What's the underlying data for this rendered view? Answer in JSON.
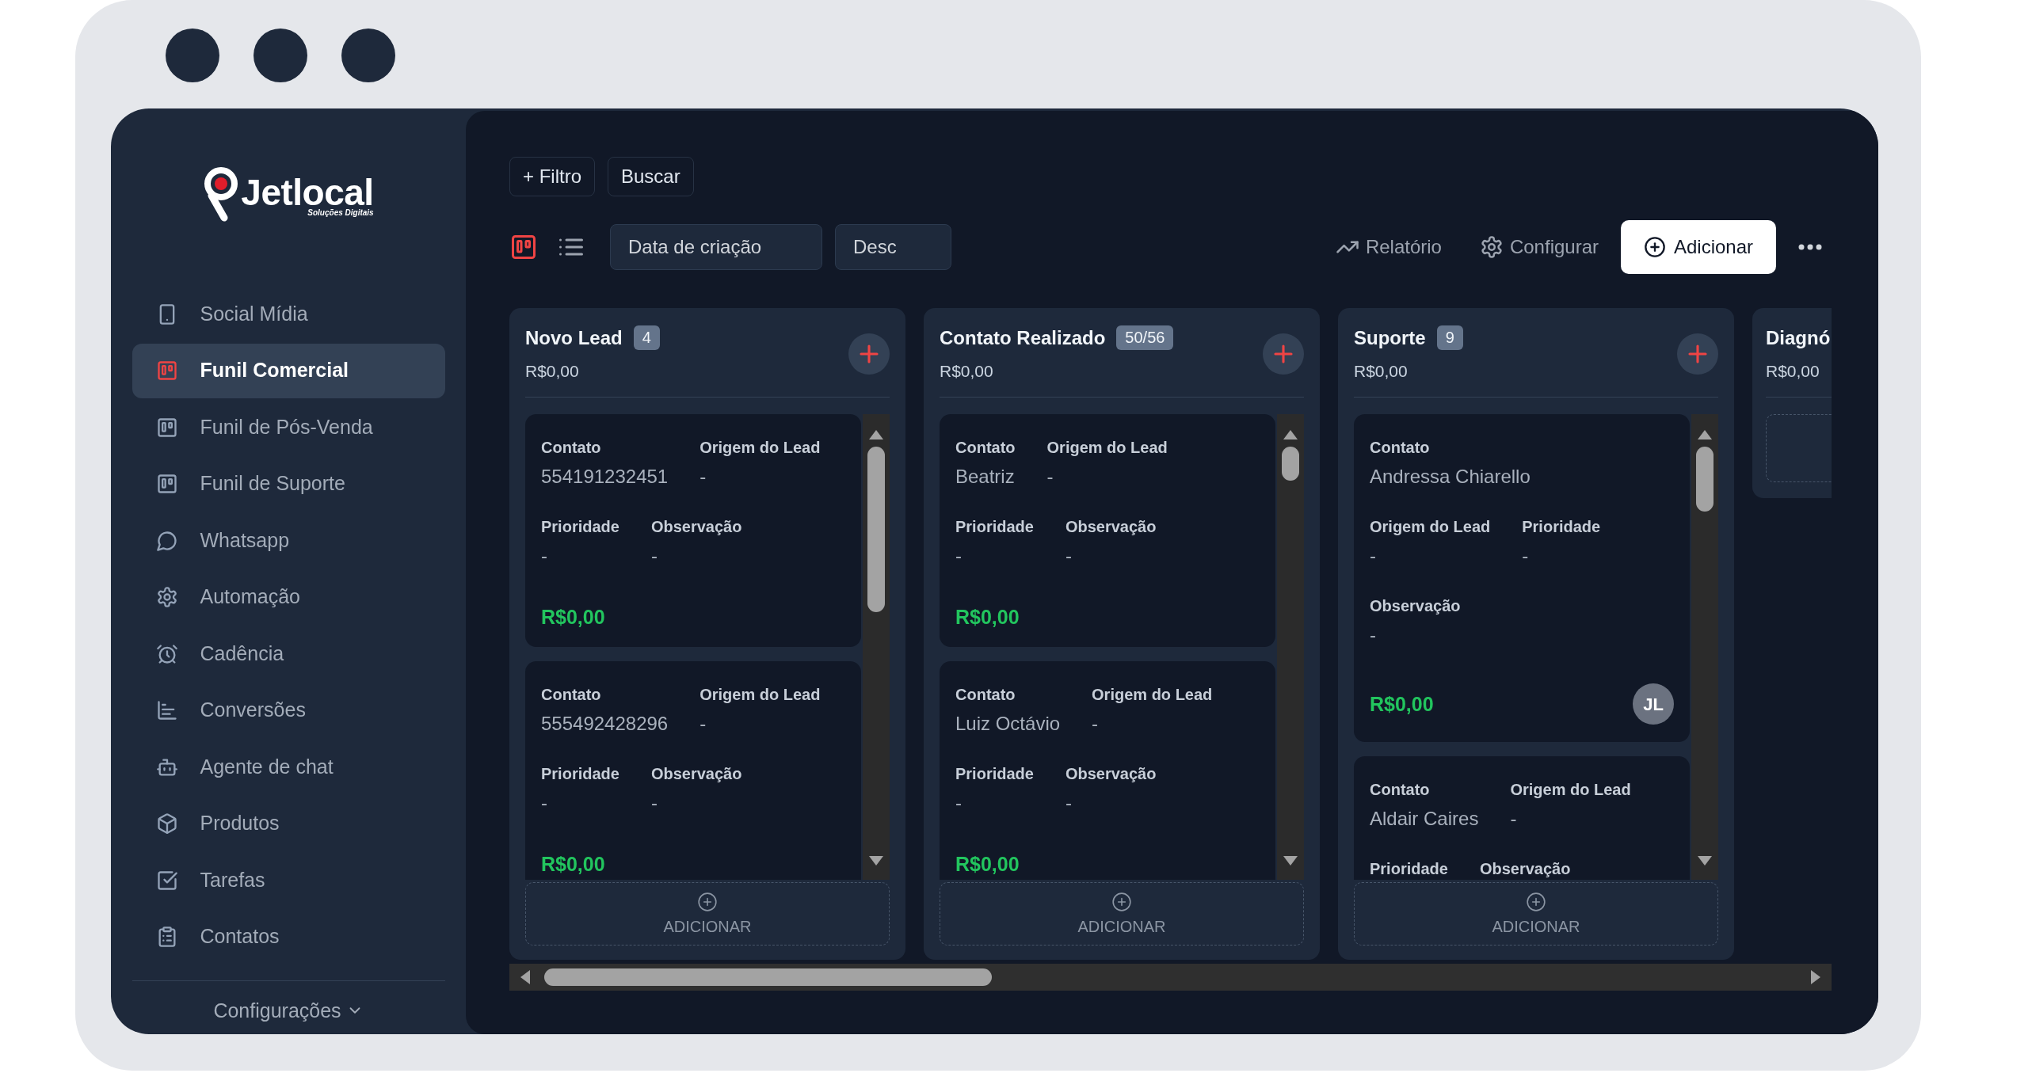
{
  "logo": {
    "wordmark": "Jetlocal",
    "tagline": "Soluções Digitais"
  },
  "sidebar": {
    "items": [
      {
        "label": "Social Mídia",
        "selected": false
      },
      {
        "label": "Funil Comercial",
        "selected": true
      },
      {
        "label": "Funil de Pós-Venda",
        "selected": false
      },
      {
        "label": "Funil de Suporte",
        "selected": false
      },
      {
        "label": "Whatsapp",
        "selected": false
      },
      {
        "label": "Automação",
        "selected": false
      },
      {
        "label": "Cadência",
        "selected": false
      },
      {
        "label": "Conversões",
        "selected": false
      },
      {
        "label": "Agente de chat",
        "selected": false
      },
      {
        "label": "Produtos",
        "selected": false
      },
      {
        "label": "Tarefas",
        "selected": false
      },
      {
        "label": "Contatos",
        "selected": false
      }
    ],
    "footer_menu": "Configurações"
  },
  "toolbar": {
    "filter_buttons": [
      "+ Filtro",
      "Buscar"
    ],
    "view_modes": [
      {
        "selected": true
      },
      {
        "selected": false
      }
    ],
    "sort_field": {
      "value": "Data de criação"
    },
    "sort_order": {
      "value": "Desc"
    },
    "actions": [
      {
        "label": "Relatório"
      },
      {
        "label": "Configurar"
      }
    ],
    "primary_button": "Adicionar"
  },
  "board": {
    "columns": [
      {
        "title": "Novo Lead",
        "count": "4",
        "amount": "R$0,00",
        "cut_off": false,
        "cards": [
          {
            "rows": [
              [
                {
                  "label": "Contato",
                  "value": "554191232451"
                },
                {
                  "label": "Origem do Lead",
                  "value": "-"
                }
              ],
              [
                {
                  "label": "Prioridade",
                  "value": "-"
                },
                {
                  "label": "Observação",
                  "value": "-"
                }
              ]
            ],
            "amount": "R$0,00"
          },
          {
            "rows": [
              [
                {
                  "label": "Contato",
                  "value": "555492428296"
                },
                {
                  "label": "Origem do Lead",
                  "value": "-"
                }
              ],
              [
                {
                  "label": "Prioridade",
                  "value": "-"
                },
                {
                  "label": "Observação",
                  "value": "-"
                }
              ]
            ],
            "amount": "R$0,00"
          }
        ],
        "add_label": "ADICIONAR"
      },
      {
        "title": "Contato Realizado",
        "count": "50/56",
        "amount": "R$0,00",
        "cut_off": false,
        "cards": [
          {
            "rows": [
              [
                {
                  "label": "Contato",
                  "value": "Beatriz"
                },
                {
                  "label": "Origem do Lead",
                  "value": "-"
                }
              ],
              [
                {
                  "label": "Prioridade",
                  "value": "-"
                },
                {
                  "label": "Observação",
                  "value": "-"
                }
              ]
            ],
            "amount": "R$0,00"
          },
          {
            "rows": [
              [
                {
                  "label": "Contato",
                  "value": "Luiz Octávio"
                },
                {
                  "label": "Origem do Lead",
                  "value": "-"
                }
              ],
              [
                {
                  "label": "Prioridade",
                  "value": "-"
                },
                {
                  "label": "Observação",
                  "value": "-"
                }
              ]
            ],
            "amount": "R$0,00"
          }
        ],
        "add_label": "ADICIONAR"
      },
      {
        "title": "Suporte",
        "count": "9",
        "amount": "R$0,00",
        "cut_off": false,
        "cards": [
          {
            "rows": [
              [
                {
                  "label": "Contato",
                  "value": "Andressa Chiarello"
                }
              ],
              [
                {
                  "label": "Origem do Lead",
                  "value": "-"
                },
                {
                  "label": "Prioridade",
                  "value": "-"
                }
              ],
              [
                {
                  "label": "Observação",
                  "value": "-"
                }
              ]
            ],
            "amount": "R$0,00",
            "assignee": "JL"
          },
          {
            "rows": [
              [
                {
                  "label": "Contato",
                  "value": "Aldair Caires"
                },
                {
                  "label": "Origem do Lead",
                  "value": "-"
                }
              ],
              [
                {
                  "label": "Prioridade"
                },
                {
                  "label": "Observação"
                }
              ]
            ]
          }
        ],
        "add_label": "ADICIONAR"
      },
      {
        "title": "Diagnó",
        "amount": "R$0,00",
        "cut_off": true
      }
    ]
  }
}
